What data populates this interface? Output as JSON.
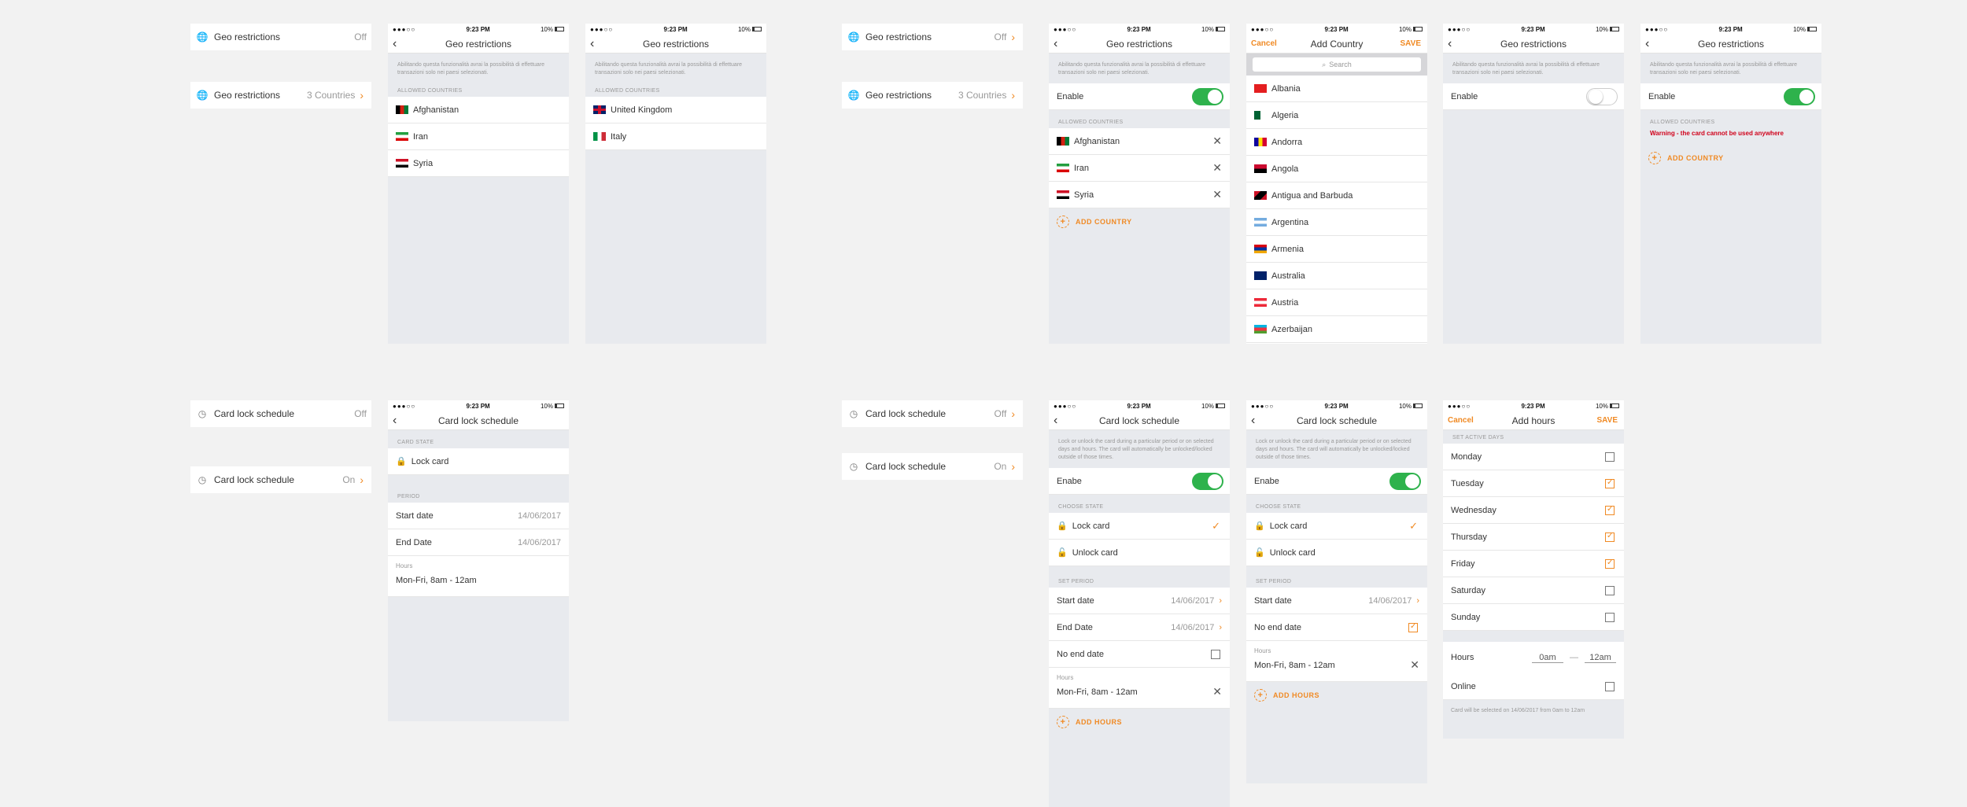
{
  "status": {
    "signal": "●●●○○",
    "time": "9:23 PM",
    "battery": "10%"
  },
  "geo": {
    "title": "Geo restrictions",
    "off": "Off",
    "countries_summary": "3 Countries",
    "description": "Abilitando questa funzionalità avrai la possibilità di effettuare transazioni solo nei paesi selezionati.",
    "allowed_header": "ALLOWED COUNTRIES",
    "enable": "Enable",
    "add_country": "ADD COUNTRY",
    "warning": "Warning - the card cannot be used anywhere",
    "list_a": [
      "Afghanistan",
      "Iran",
      "Syria"
    ],
    "list_b": [
      "United Kingdom",
      "Italy"
    ]
  },
  "add_country": {
    "cancel": "Cancel",
    "title": "Add Country",
    "save": "SAVE",
    "search_placeholder": "Search",
    "countries": [
      "Albania",
      "Algeria",
      "Andorra",
      "Angola",
      "Antigua and Barbuda",
      "Argentina",
      "Armenia",
      "Australia",
      "Austria",
      "Azerbaijan"
    ]
  },
  "lock": {
    "title": "Card lock schedule",
    "off": "Off",
    "on": "On",
    "card_state": "CARD STATE",
    "lock_card": "Lock card",
    "unlock_card": "Unlock card",
    "period": "PERIOD",
    "start_date": "Start date",
    "end_date": "End Date",
    "date_value": "14/06/2017",
    "hours_label": "Hours",
    "hours_value": "Mon-Fri, 8am - 12am",
    "description": "Lock or unlock the card during a particular period or on selected days and hours. The card will automatically be unlocked/locked outside of those times.",
    "enable": "Enabe",
    "choose_state": "CHOOSE STATE",
    "set_period": "SET PERIOD",
    "no_end_date": "No end date",
    "add_hours": "ADD HOURS"
  },
  "add_hours": {
    "cancel": "Cancel",
    "title": "Add hours",
    "save": "SAVE",
    "set_active_days": "SET ACTIVE DAYS",
    "days": [
      "Monday",
      "Tuesday",
      "Wednesday",
      "Thursday",
      "Friday",
      "Saturday",
      "Sunday"
    ],
    "hours_label": "Hours",
    "from": "0am",
    "dash": "—",
    "to": "12am",
    "online": "Online",
    "note": "Card will be selected on 14/06/2017 from 0am to 12am"
  }
}
